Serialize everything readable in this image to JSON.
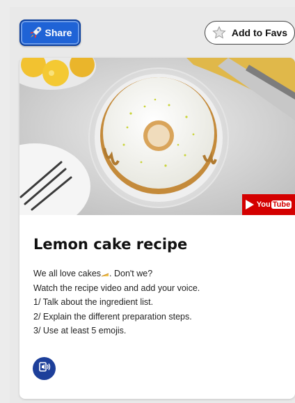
{
  "header": {
    "share_label": "Share",
    "fav_label": "Add to Favs"
  },
  "media": {
    "badge": {
      "word_you": "You",
      "word_tube": "Tube"
    }
  },
  "card": {
    "title": "Lemon cake recipe",
    "lines": [
      "We all love cakes",
      ". Don't we?",
      "Watch the recipe video and add your voice.",
      "1/ Talk about the ingredient list.",
      "2/ Explain the different preparation steps.",
      "3/ Use at least 5 emojis."
    ]
  },
  "colors": {
    "share_blue": "#1f63d6",
    "youtube_red": "#d40000",
    "audio_button_navy": "#1d3f9a"
  },
  "icons": {
    "share": "rocket-icon",
    "fav": "star-icon",
    "youtube": "youtube-logo",
    "audio": "speaker-icon",
    "cake_emoji": "cake-emoji-icon"
  }
}
